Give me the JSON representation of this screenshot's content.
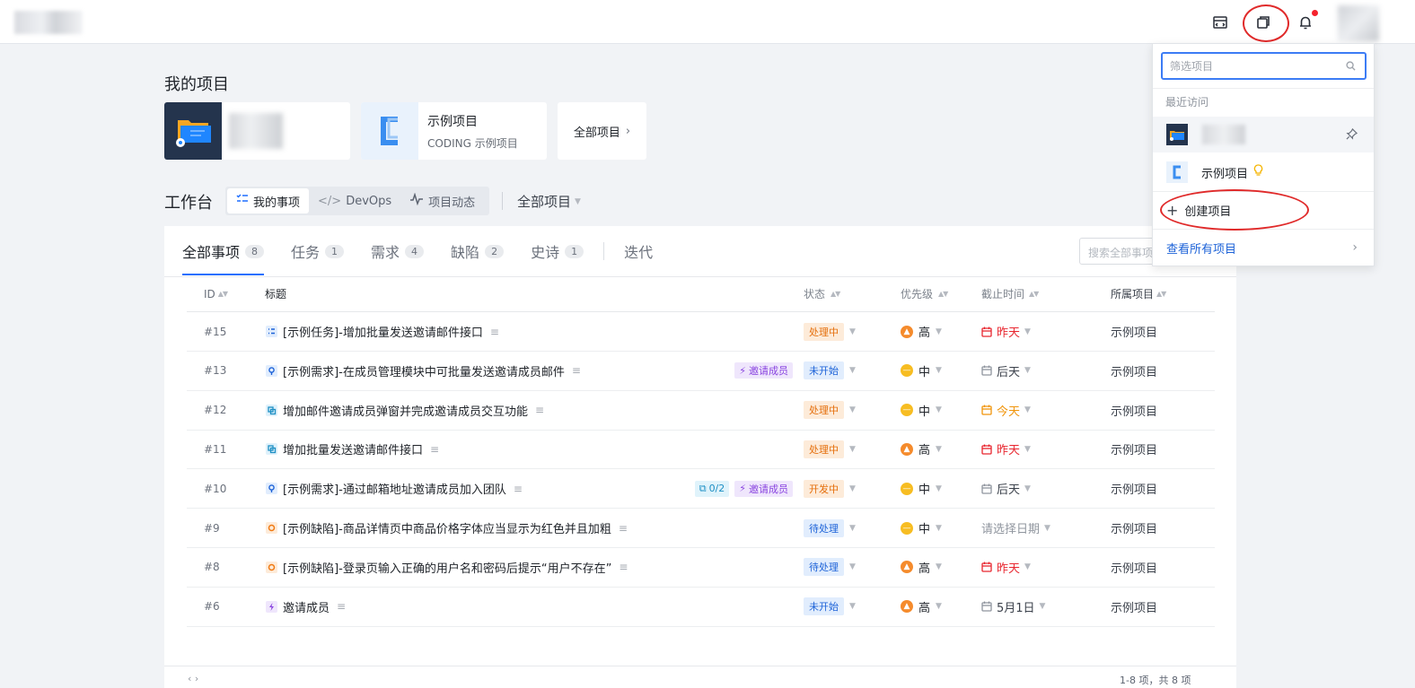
{
  "topbar": {
    "icons": [
      "layout-icon",
      "copy-window-icon",
      "bell-icon"
    ],
    "has_notification": true
  },
  "my_projects": {
    "title": "我的项目",
    "cards": [
      {
        "name": "",
        "subtitle": "",
        "icon": "folder-gear-icon"
      },
      {
        "name": "示例项目",
        "subtitle": "CODING 示例项目",
        "icon": "coding-logo-icon"
      }
    ],
    "all_projects_label": "全部项目"
  },
  "workbench": {
    "title": "工作台",
    "tabs": [
      {
        "label": "我的事项",
        "icon": "checklist-icon",
        "active": true
      },
      {
        "label": "DevOps",
        "icon": "code-icon",
        "active": false
      },
      {
        "label": "项目动态",
        "icon": "activity-icon",
        "active": false
      }
    ],
    "project_filter": "全部项目"
  },
  "panel": {
    "tabs": [
      {
        "label": "全部事项",
        "count": "8",
        "active": true
      },
      {
        "label": "任务",
        "count": "1",
        "active": false
      },
      {
        "label": "需求",
        "count": "4",
        "active": false
      },
      {
        "label": "缺陷",
        "count": "2",
        "active": false
      },
      {
        "label": "史诗",
        "count": "1",
        "active": false
      }
    ],
    "extra_tab": "迭代",
    "search_placeholder": "搜索全部事项",
    "columns": {
      "id": "ID",
      "title": "标题",
      "status": "状态",
      "priority": "优先级",
      "due": "截止时间",
      "project": "所属项目"
    },
    "rows": [
      {
        "id": "#15",
        "type": "task",
        "title": "[示例任务]-增加批量发送邀请邮件接口",
        "tags": [],
        "status": "处理中",
        "status_color": "orange",
        "priority": "高",
        "pri_level": "high",
        "due": "昨天",
        "due_style": "red",
        "project": "示例项目"
      },
      {
        "id": "#13",
        "type": "requirement",
        "title": "[示例需求]-在成员管理模块中可批量发送邀请成员邮件",
        "tags": [
          {
            "kind": "epic",
            "label": "邀请成员"
          }
        ],
        "status": "未开始",
        "status_color": "blue",
        "priority": "中",
        "pri_level": "mid",
        "due": "后天",
        "due_style": "gray",
        "project": "示例项目"
      },
      {
        "id": "#12",
        "type": "subtask",
        "title": "增加邮件邀请成员弹窗并完成邀请成员交互功能",
        "tags": [],
        "status": "处理中",
        "status_color": "orange",
        "priority": "中",
        "pri_level": "mid",
        "due": "今天",
        "due_style": "orange",
        "project": "示例项目"
      },
      {
        "id": "#11",
        "type": "subtask",
        "title": "增加批量发送邀请邮件接口",
        "tags": [],
        "status": "处理中",
        "status_color": "orange",
        "priority": "高",
        "pri_level": "high",
        "due": "昨天",
        "due_style": "red",
        "project": "示例项目"
      },
      {
        "id": "#10",
        "type": "requirement",
        "title": "[示例需求]-通过邮箱地址邀请成员加入团队",
        "tags": [
          {
            "kind": "subtask",
            "label": "0/2"
          },
          {
            "kind": "epic",
            "label": "邀请成员"
          }
        ],
        "status": "开发中",
        "status_color": "orange",
        "priority": "中",
        "pri_level": "mid",
        "due": "后天",
        "due_style": "gray",
        "project": "示例项目"
      },
      {
        "id": "#9",
        "type": "defect",
        "title": "[示例缺陷]-商品详情页中商品价格字体应当显示为红色并且加粗",
        "tags": [],
        "status": "待处理",
        "status_color": "blue",
        "priority": "中",
        "pri_level": "mid",
        "due": "请选择日期",
        "due_style": "placeholder",
        "project": "示例项目"
      },
      {
        "id": "#8",
        "type": "defect",
        "title": "[示例缺陷]-登录页输入正确的用户名和密码后提示“用户不存在”",
        "tags": [],
        "status": "待处理",
        "status_color": "blue",
        "priority": "高",
        "pri_level": "high",
        "due": "昨天",
        "due_style": "red",
        "project": "示例项目"
      },
      {
        "id": "#6",
        "type": "epic",
        "title": "邀请成员",
        "tags": [],
        "status": "未开始",
        "status_color": "blue",
        "priority": "高",
        "pri_level": "high",
        "due": "5月1日",
        "due_style": "gray",
        "project": "示例项目"
      }
    ],
    "pager_left": "‹   ›",
    "pager_right": "1-8 项，共 8 项"
  },
  "dropdown": {
    "search_placeholder": "筛选项目",
    "recent_label": "最近访问",
    "recent_items": [
      {
        "name": "",
        "icon": "folder-gear-icon",
        "pinned": true
      },
      {
        "name": "示例项目",
        "icon": "coding-logo-icon",
        "bulb": true
      }
    ],
    "create_label": "创建项目",
    "view_all_label": "查看所有项目"
  },
  "colors": {
    "primary": "#1e6fff",
    "annotation_red": "#e02a2a",
    "status_orange": "#e56f0c",
    "status_blue": "#1e63d8",
    "priority_high": "#f58b2c",
    "priority_mid": "#f7bd22",
    "due_red": "#e8262f",
    "due_orange": "#f0940a",
    "epic_purple": "#8a45e0"
  }
}
